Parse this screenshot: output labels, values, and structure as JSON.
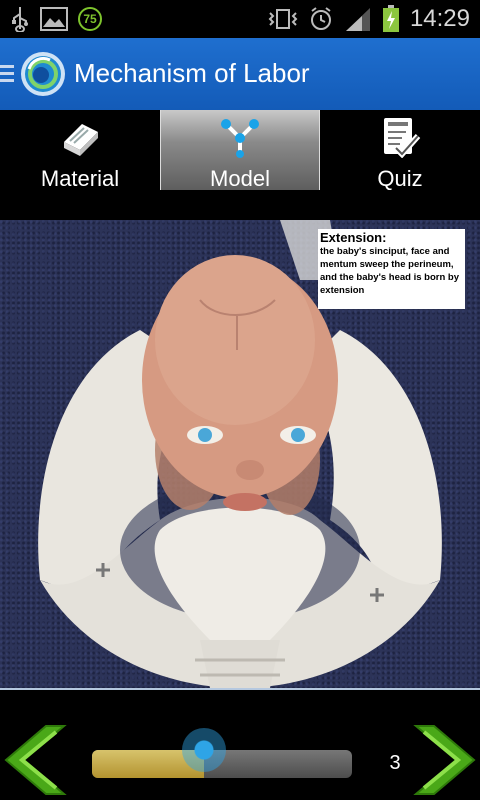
{
  "statusbar": {
    "time": "14:29",
    "notification_count": "75"
  },
  "app": {
    "title": "Mechanism of Labor",
    "accent_color": "#1e6ccc"
  },
  "tabs": [
    {
      "label": "Material",
      "icon": "book-icon",
      "active": false
    },
    {
      "label": "Model",
      "icon": "molecule-icon",
      "active": true
    },
    {
      "label": "Quiz",
      "icon": "checklist-icon",
      "active": false
    }
  ],
  "caption": {
    "title": "Extension:",
    "body": "the baby's sinciput, face and mentum sweep the perineum, and the baby's head is born by extension"
  },
  "player": {
    "slide_number": "3",
    "progress": 0.43,
    "prev_icon": "chevron-left-icon",
    "next_icon": "chevron-right-icon"
  }
}
